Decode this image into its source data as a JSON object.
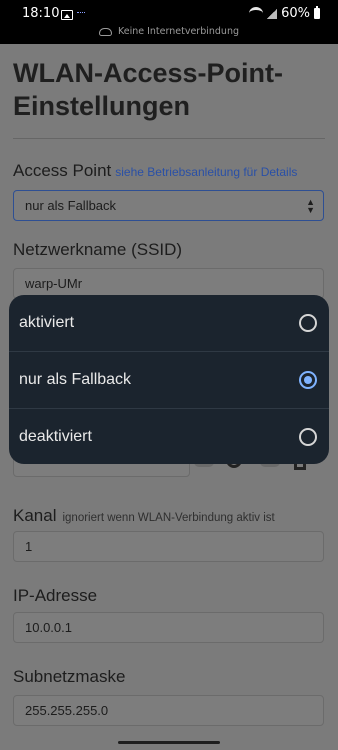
{
  "statusbar": {
    "time": "18:10",
    "battery": "60%",
    "network_notice": "Keine Internetverbindung"
  },
  "page": {
    "title": "WLAN-Access-Point-Einstellungen",
    "access_point": {
      "label": "Access Point",
      "hint_link": "siehe Betriebsanleitung für Details",
      "selected": "nur als Fallback"
    },
    "ssid": {
      "label": "Netzwerkname (SSID)",
      "value": "warp-UMr"
    },
    "password": {
      "value": "••••••••••••"
    },
    "kanal": {
      "label": "Kanal",
      "hint": "ignoriert wenn WLAN-Verbindung aktiv ist",
      "value": "1"
    },
    "ip": {
      "label": "IP-Adresse",
      "value": "10.0.0.1"
    },
    "subnet": {
      "label": "Subnetzmaske",
      "value": "255.255.255.0"
    }
  },
  "dropdown": {
    "options": [
      {
        "label": "aktiviert",
        "selected": false
      },
      {
        "label": "nur als Fallback",
        "selected": true
      },
      {
        "label": "deaktiviert",
        "selected": false
      }
    ]
  },
  "colors": {
    "accent_radio": "#7fb3ff",
    "menu_bg": "#1b242e",
    "link": "#2a50a6"
  }
}
